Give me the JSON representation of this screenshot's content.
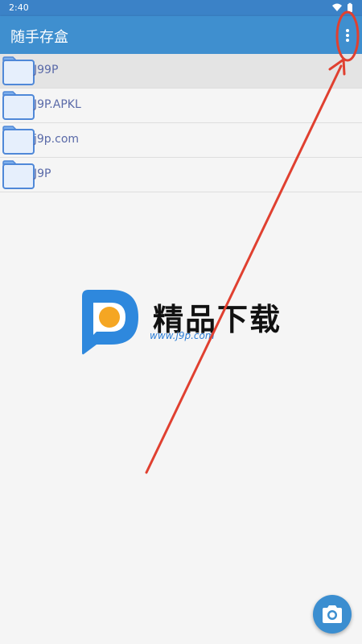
{
  "status_bar": {
    "time": "2:40",
    "icons": [
      "wifi-icon",
      "battery-icon"
    ]
  },
  "app_bar": {
    "title": "随手存盒",
    "menu_icon": "more-vert-icon"
  },
  "files": [
    {
      "name": "J99P",
      "icon": "folder-icon",
      "selected": true
    },
    {
      "name": "J9P.APKL",
      "icon": "folder-icon"
    },
    {
      "name": "j9p.com",
      "icon": "folder-icon"
    },
    {
      "name": "J9P",
      "icon": "folder-icon"
    }
  ],
  "watermark": {
    "brand": "精品下载",
    "url": "www.j9p.com"
  },
  "fab": {
    "icon": "camera-icon"
  },
  "annotation": {
    "color": "#e04030",
    "target": "overflow-menu"
  },
  "colors": {
    "app_bar": "#3f8fcf",
    "status_bar": "#3b82c7",
    "file_name": "#5a6aa8",
    "fab": "#3b8ed0"
  }
}
